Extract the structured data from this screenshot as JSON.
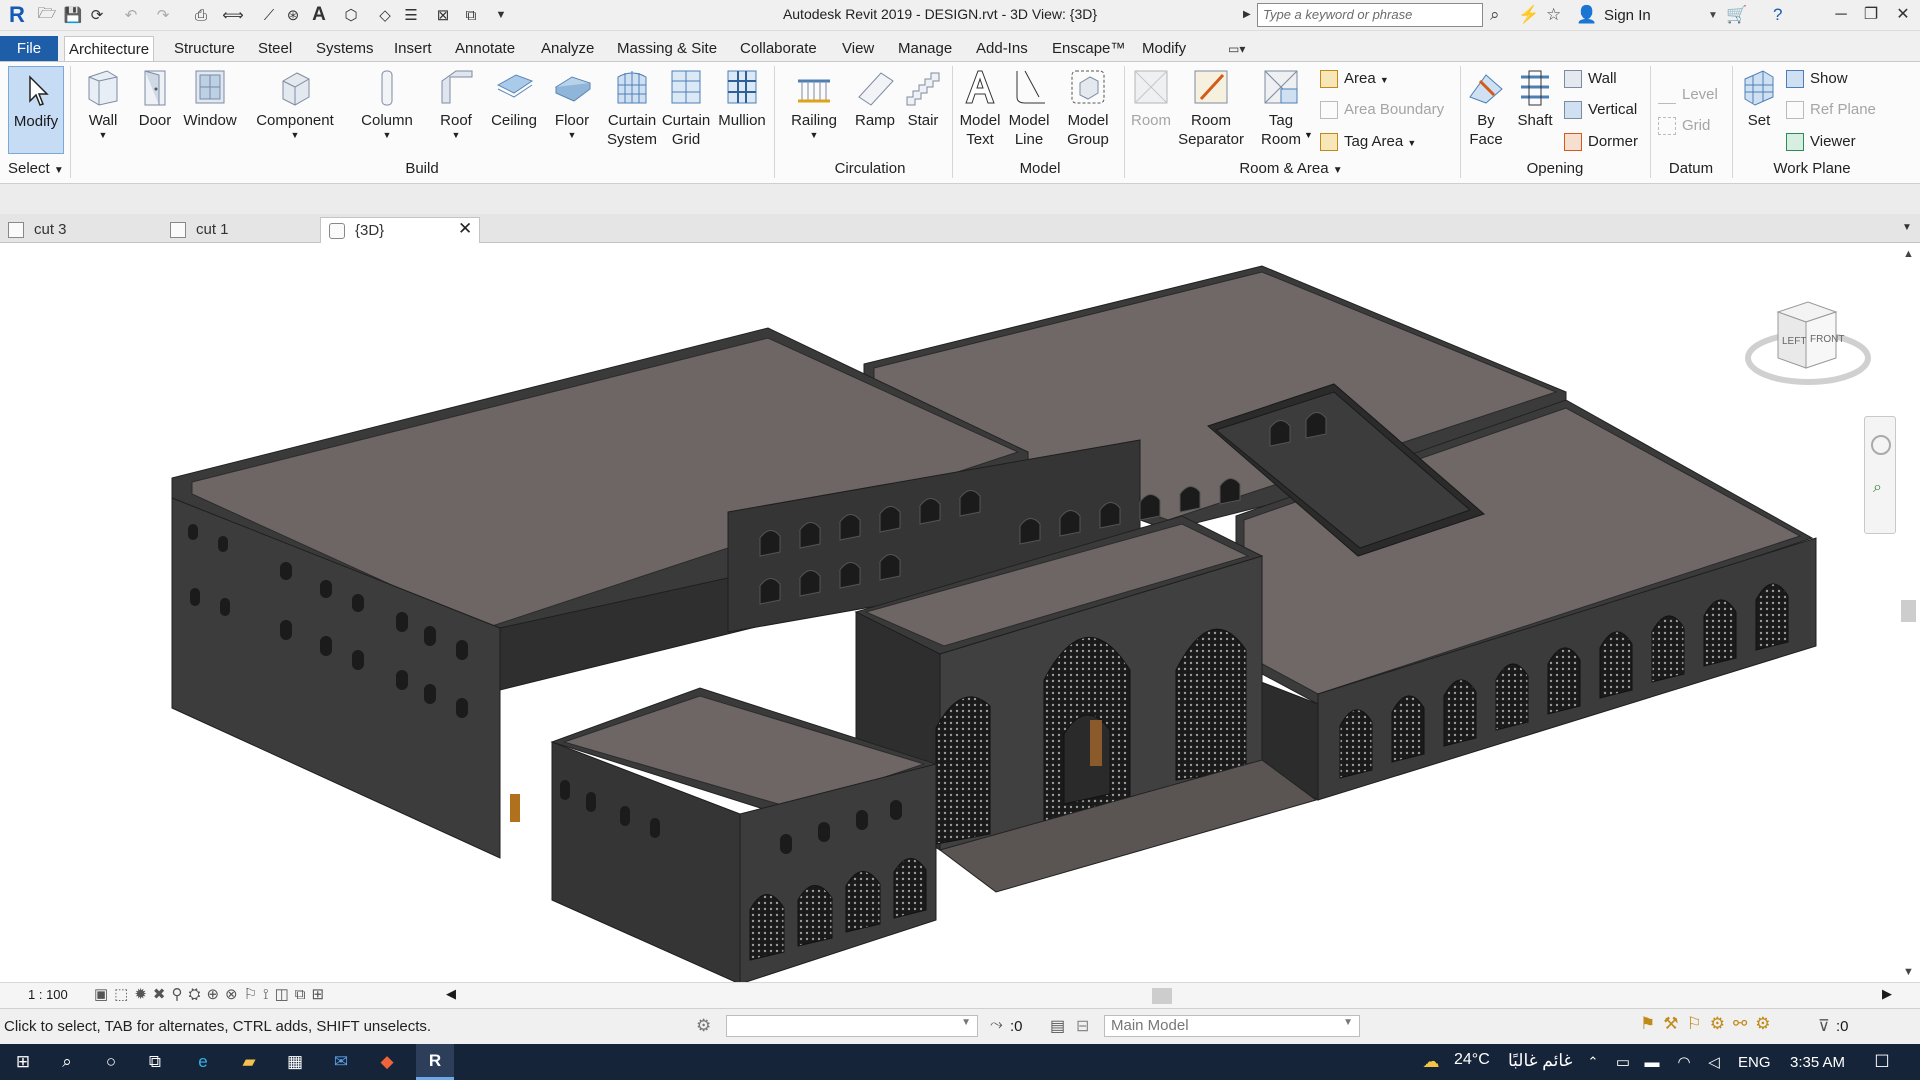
{
  "window": {
    "title": "Autodesk Revit 2019 - DESIGN.rvt - 3D View: {3D}",
    "search_placeholder": "Type a keyword or phrase",
    "sign_in": "Sign In"
  },
  "ribbon_tabs": [
    "File",
    "Architecture",
    "Structure",
    "Steel",
    "Systems",
    "Insert",
    "Annotate",
    "Analyze",
    "Massing & Site",
    "Collaborate",
    "View",
    "Manage",
    "Add-Ins",
    "Enscape™",
    "Modify"
  ],
  "select": {
    "modify_label": "Modify",
    "select_label": "Select"
  },
  "build": {
    "panel_label": "Build",
    "wall": "Wall",
    "door": "Door",
    "window": "Window",
    "component": "Component",
    "column": "Column",
    "roof": "Roof",
    "ceiling": "Ceiling",
    "floor": "Floor",
    "curtain_system_1": "Curtain",
    "curtain_system_2": "System",
    "curtain_grid_1": "Curtain",
    "curtain_grid_2": "Grid",
    "mullion": "Mullion"
  },
  "circulation": {
    "panel_label": "Circulation",
    "railing": "Railing",
    "ramp": "Ramp",
    "stair": "Stair"
  },
  "model": {
    "panel_label": "Model",
    "model_text_1": "Model",
    "model_text_2": "Text",
    "model_line_1": "Model",
    "model_line_2": "Line",
    "model_group_1": "Model",
    "model_group_2": "Group"
  },
  "room_area": {
    "panel_label": "Room & Area",
    "room": "Room",
    "room_separator_1": "Room",
    "room_separator_2": "Separator",
    "tag_room_1": "Tag",
    "tag_room_2": "Room",
    "area": "Area",
    "area_boundary": "Area  Boundary",
    "tag_area": "Tag  Area"
  },
  "opening": {
    "panel_label": "Opening",
    "by_face_1": "By",
    "by_face_2": "Face",
    "shaft": "Shaft",
    "wall": "Wall",
    "vertical": "Vertical",
    "dormer": "Dormer"
  },
  "datum": {
    "panel_label": "Datum",
    "level": "Level",
    "grid": "Grid"
  },
  "work_plane": {
    "panel_label": "Work Plane",
    "set": "Set",
    "show": "Show",
    "ref_plane": "Ref  Plane",
    "viewer": "Viewer"
  },
  "view_tabs": [
    {
      "label": "cut 3"
    },
    {
      "label": "cut 1"
    },
    {
      "label": "{3D}"
    }
  ],
  "viewcube": {
    "left": "LEFT",
    "front": "FRONT"
  },
  "view_control": {
    "scale": "1 : 100"
  },
  "status": {
    "hint": "Click to select, TAB for alternates, CTRL adds, SHIFT unselects.",
    "filter_count": ":0",
    "model": "Main Model",
    "selection_count": ":0"
  },
  "taskbar": {
    "temperature": "24°C",
    "weather": "غائم غالبًا",
    "language": "ENG",
    "time": "3:35 AM"
  },
  "colors": {
    "accent": "#1e5ea8",
    "roof": "#6e6664",
    "wall": "#3c3c3c",
    "taskbar": "#16243a"
  }
}
